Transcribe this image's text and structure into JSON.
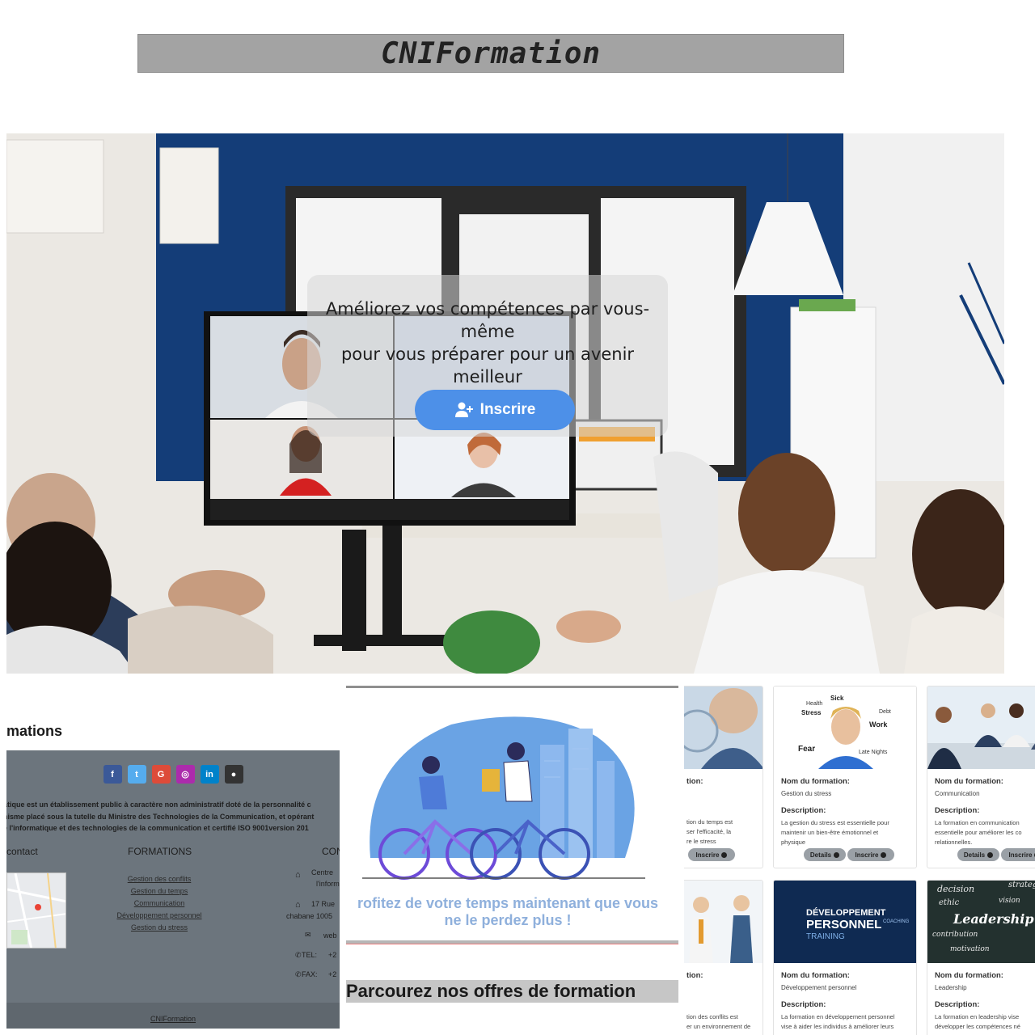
{
  "header": {
    "brand": "CNIFormation"
  },
  "hero": {
    "line1": "Améliorez vos compétences par vous-même",
    "line2": "pour vous préparer pour un avenir meilleur",
    "cta_label": "Inscrire"
  },
  "formations_section": {
    "title_partial": "mations"
  },
  "footer": {
    "social": [
      "f",
      "t",
      "G",
      "ig",
      "in",
      "gh"
    ],
    "about_lines": [
      "atique est un établissement public à caractère non administratif doté de la personnalité c",
      "nisme placé sous la tutelle du Ministre des Technologies de la Communication, et opérant",
      "e l'informatique et des technologies de la communication et certifié ISO 9001version 201"
    ],
    "contact_head": "contact",
    "formations_head": "FORMATIONS",
    "third_head": "CON",
    "formation_links": [
      "Gestion des conflits",
      "Gestion du temps",
      "Communication",
      "Développement personnel",
      "Gestion du stress"
    ],
    "address_a": "Centre",
    "address_b": "l'inform",
    "street": "17 Rue",
    "city": "chabane 1005",
    "web": "web",
    "tel_label": "TEL:",
    "tel_value": "+2",
    "fax_label": "FAX:",
    "fax_value": "+2",
    "copyright": "CNIFormation"
  },
  "promo": {
    "line1": "rofitez de votre temps maintenant que vous",
    "line2": "ne le perdez plus !",
    "browse_title": "Parcourez nos offres de formation"
  },
  "cards": {
    "name_label_partial": "tion:",
    "name_label": "Nom du formation:",
    "desc_label": "Description:",
    "details": "Details",
    "inscrire": "Inscrire",
    "c1": {
      "desc1": "tion du temps est",
      "desc2": "ser l'efficacité, la",
      "desc3": "re le stress"
    },
    "c2": {
      "name": "Gestion du stress",
      "desc1": "La gestion du stress est essentielle pour",
      "desc2": "maintenir un bien-être émotionnel et",
      "desc3": "physique"
    },
    "c3": {
      "name": "Communication",
      "desc1": "La formation en communication",
      "desc2": "essentielle pour améliorer les co",
      "desc3": "relationnelles."
    },
    "c4": {
      "desc1": "tion des conflits est",
      "desc2": "er un environnement de"
    },
    "c5": {
      "name": "Développement personnel",
      "desc1": "La formation en développement personnel",
      "desc2": "vise à aider les individus à améliorer leurs"
    },
    "c6": {
      "name": "Leadership",
      "desc1": "La formation en leadership vise",
      "desc2": "développer les compétences né"
    },
    "stress_words": [
      "Sick",
      "Health",
      "Stress",
      "Work",
      "Fear",
      "Late Nights",
      "Debt"
    ],
    "dev_words": [
      "DÉVELOPPEMENT",
      "PERSONNEL",
      "TRAINING",
      "COACHING"
    ],
    "lead_words": [
      "decision",
      "strateg",
      "ethic",
      "vision",
      "Leadership",
      "contribution",
      "motivation"
    ]
  },
  "colors": {
    "brand_bar": "#a3a3a3",
    "hero_button": "#4d90e8",
    "footer": "#6c757d",
    "social_facebook": "#3b5998",
    "social_twitter": "#55acee",
    "social_google": "#dd4b39",
    "social_instagram": "#ac2bac",
    "social_linkedin": "#0082ca",
    "social_github": "#333333"
  }
}
